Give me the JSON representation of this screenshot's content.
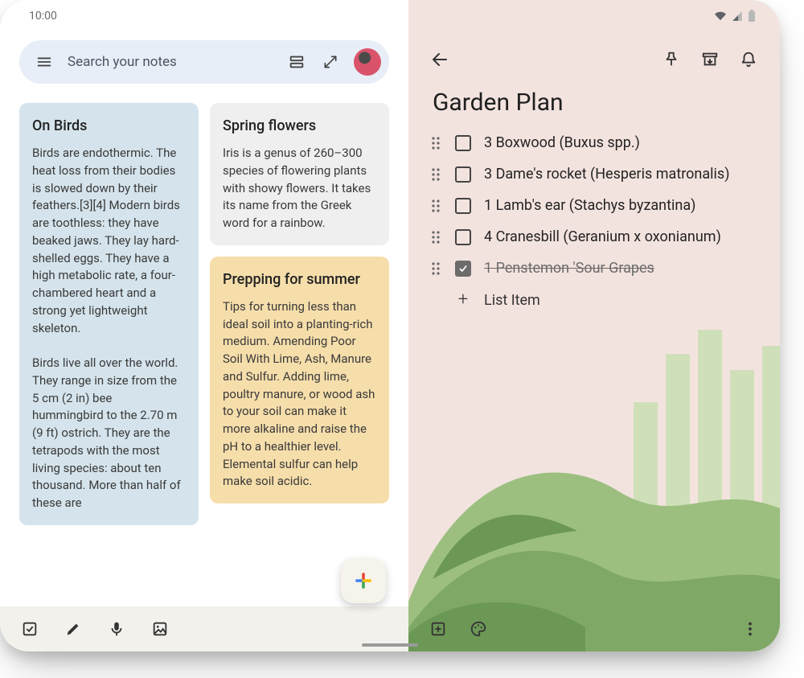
{
  "statusbar": {
    "time": "10:00"
  },
  "search": {
    "placeholder": "Search your notes"
  },
  "notes": {
    "birds": {
      "title": "On Birds",
      "p1": "Birds are endothermic. The heat loss from their bodies is slowed down by their feathers.[3][4] Modern birds are toothless: they have beaked jaws. They lay hard-shelled eggs. They have a high metabolic rate, a four-chambered heart and a strong yet lightweight skeleton.",
      "p2": "Birds live all over the world. They range in size from the 5 cm (2 in) bee hummingbird to the 2.70 m (9 ft) ostrich. They are the tetrapods with the most living species: about ten thousand. More than half of these are"
    },
    "spring": {
      "title": "Spring flowers",
      "body": "Iris is a genus of 260–300 species of flowering plants with showy flowers. It takes its name from the Greek word for a rainbow."
    },
    "summer": {
      "title": "Prepping for summer",
      "body": "Tips for turning less than ideal soil into a planting-rich medium. Amending Poor Soil With Lime, Ash, Manure and Sulfur. Adding lime, poultry manure, or wood ash to your soil can make it more alkaline and raise the pH to a healthier level. Elemental sulfur can help make soil acidic."
    }
  },
  "detail": {
    "title": "Garden Plan",
    "items": [
      {
        "label": "3 Boxwood (Buxus spp.)",
        "done": false
      },
      {
        "label": "3 Dame's rocket (Hesperis matronalis)",
        "done": false
      },
      {
        "label": "1 Lamb's ear (Stachys byzantina)",
        "done": false
      },
      {
        "label": "4 Cranesbill (Geranium x oxonianum)",
        "done": false
      },
      {
        "label": "1 Penstemon 'Sour Grapes",
        "done": true
      }
    ],
    "add_label": "List Item"
  }
}
